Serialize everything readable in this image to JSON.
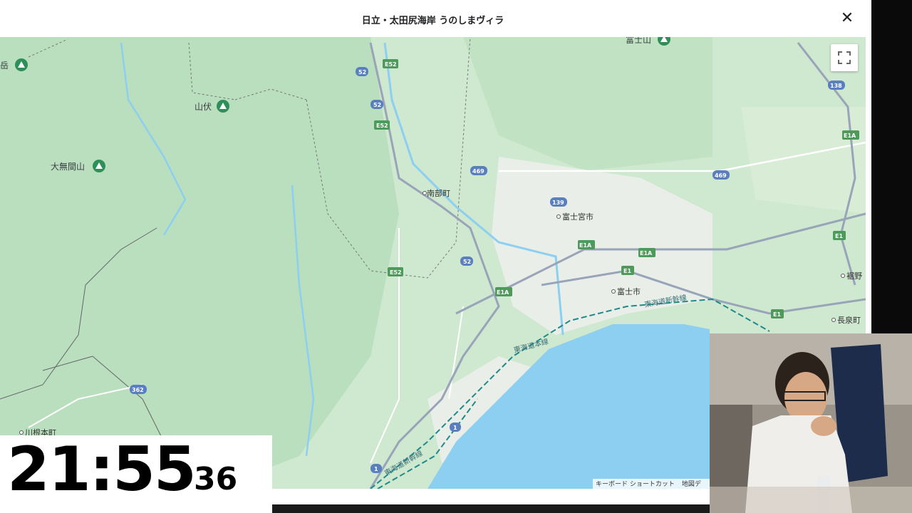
{
  "window": {
    "title": "日立・太田尻海岸 うのしまヴィラ"
  },
  "map": {
    "peaks": [
      {
        "name": "岳"
      },
      {
        "name": "山伏"
      },
      {
        "name": "大無間山"
      },
      {
        "name": "富士山"
      }
    ],
    "places": [
      {
        "name": "南部町"
      },
      {
        "name": "富士宮市"
      },
      {
        "name": "富士市"
      },
      {
        "name": "裾野"
      },
      {
        "name": "長泉町"
      },
      {
        "name": "川根本町"
      }
    ],
    "roads": [
      {
        "label": "52"
      },
      {
        "label": "52"
      },
      {
        "label": "52"
      },
      {
        "label": "E52"
      },
      {
        "label": "E52"
      },
      {
        "label": "E52"
      },
      {
        "label": "469"
      },
      {
        "label": "469"
      },
      {
        "label": "139"
      },
      {
        "label": "138"
      },
      {
        "label": "E1A"
      },
      {
        "label": "E1A"
      },
      {
        "label": "E1A"
      },
      {
        "label": "E1A"
      },
      {
        "label": "E1"
      },
      {
        "label": "E1"
      },
      {
        "label": "E1"
      },
      {
        "label": "1"
      },
      {
        "label": "1"
      },
      {
        "label": "362"
      }
    ],
    "rail": [
      {
        "name": "東海道新幹線"
      },
      {
        "name": "東海道本線"
      },
      {
        "name": "東海道新幹線"
      }
    ],
    "attribution": {
      "shortcuts": "キーボード ショートカット",
      "data": "地図デ"
    },
    "colors": {
      "land": "#cde9cf",
      "water": "#8ccff0",
      "urban": "#eef2ee",
      "expressway": "#9aa4b8",
      "shinkansen": "#1e8a8a"
    }
  },
  "clock": {
    "hm": "21:55",
    "seconds": "36"
  }
}
